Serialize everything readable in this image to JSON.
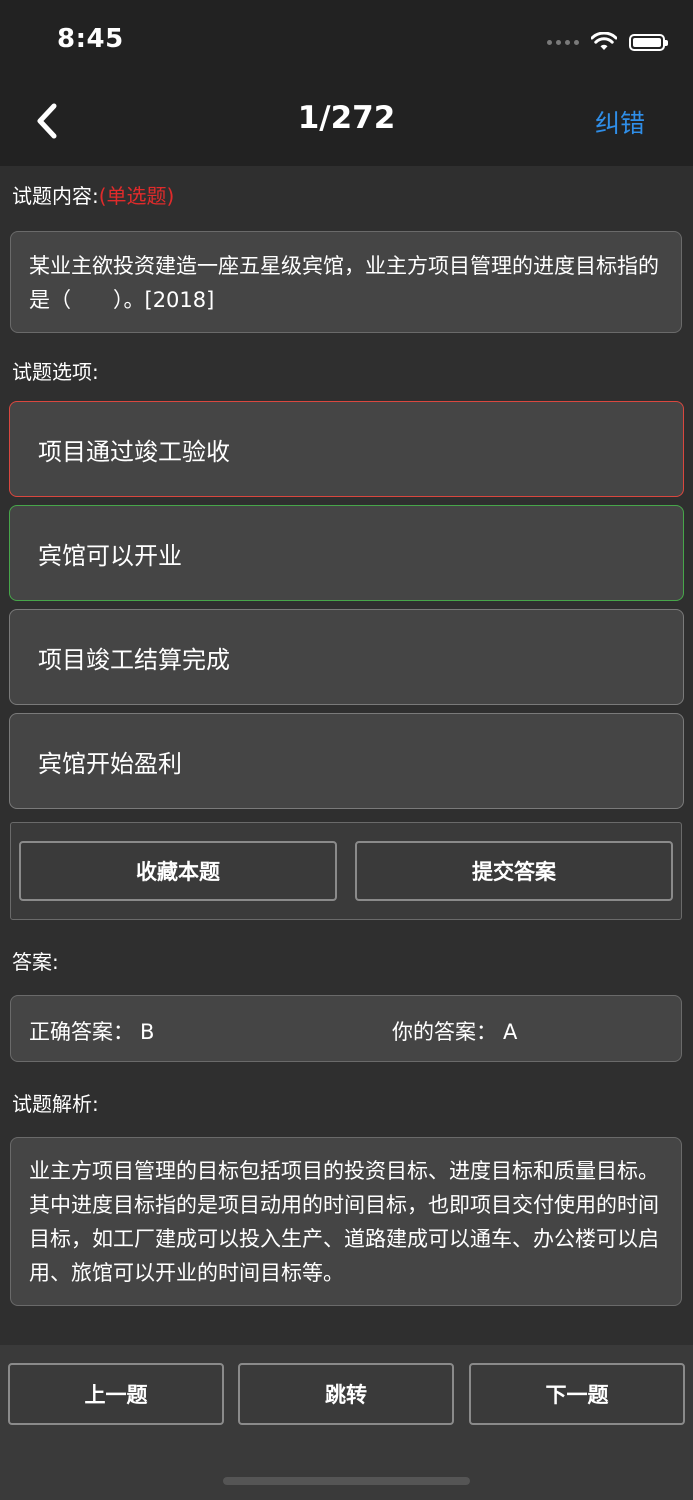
{
  "status": {
    "time": "8:45"
  },
  "nav": {
    "title": "1/272",
    "right_label": "纠错"
  },
  "question": {
    "label": "试题内容:",
    "type": "(单选题)",
    "text": "某业主欲投资建造一座五星级宾馆，业主方项目管理的进度目标指的是（　　）。[2018]"
  },
  "options": {
    "label": "试题选项:",
    "items": [
      {
        "text": "项目通过竣工验收",
        "state": "wrong"
      },
      {
        "text": "宾馆可以开业",
        "state": "correct"
      },
      {
        "text": "项目竣工结算完成",
        "state": "normal"
      },
      {
        "text": "宾馆开始盈利",
        "state": "normal"
      }
    ]
  },
  "actions": {
    "favorite": "收藏本题",
    "submit": "提交答案"
  },
  "answer": {
    "label": "答案:",
    "correct_label": "正确答案：",
    "correct_value": "B",
    "yours_label": "你的答案：",
    "yours_value": "A"
  },
  "analysis": {
    "label": "试题解析:",
    "text": "业主方项目管理的目标包括项目的投资目标、进度目标和质量目标。其中进度目标指的是项目动用的时间目标，也即项目交付使用的时间目标，如工厂建成可以投入生产、道路建成可以通车、办公楼可以启用、旅馆可以开业的时间目标等。"
  },
  "bottom": {
    "prev": "上一题",
    "jump": "跳转",
    "next": "下一题"
  },
  "colors": {
    "accent": "#2f8ee8",
    "wrong": "#d9473f",
    "correct": "#47a64a",
    "type_red": "#e02b2b"
  }
}
